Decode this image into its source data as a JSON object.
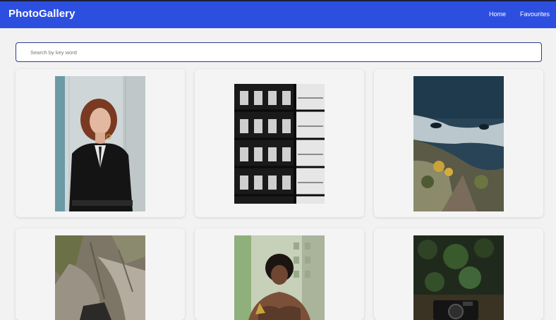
{
  "app": {
    "title": "PhotoGallery"
  },
  "nav": {
    "links": [
      "Home",
      "Favourites"
    ]
  },
  "search": {
    "placeholder": "Search by key word",
    "value": ""
  },
  "gallery": {
    "photos": [
      {
        "subject": "woman in black blazer portrait"
      },
      {
        "subject": "black and white building balconies"
      },
      {
        "subject": "rocky coastline with sea"
      },
      {
        "subject": "rock cliff texture"
      },
      {
        "subject": "curly haired man portrait"
      },
      {
        "subject": "camera in grass"
      }
    ]
  },
  "colors": {
    "navbar": "#2d4fe0",
    "background": "#f2f2f2",
    "search_border": "#2f3c8f"
  }
}
